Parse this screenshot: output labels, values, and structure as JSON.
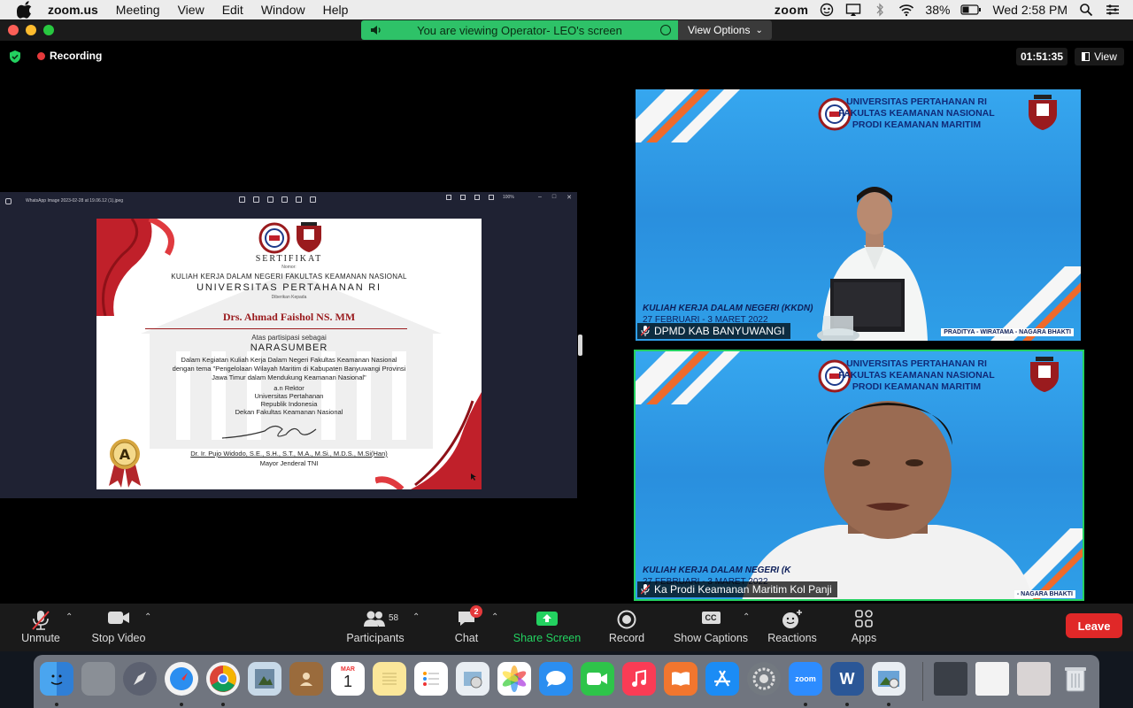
{
  "menubar": {
    "app_name": "zoom.us",
    "items": [
      "Meeting",
      "View",
      "Edit",
      "Window",
      "Help"
    ],
    "zoom_word": "zoom",
    "battery": "38%",
    "clock": "Wed 2:58 PM"
  },
  "banner": {
    "viewing_text": "You are viewing Operator- LEO's screen",
    "view_options": "View Options"
  },
  "meeting": {
    "recording_label": "Recording",
    "timer": "01:51:35",
    "view_label": "View"
  },
  "shared_screen": {
    "viewer_filename": "WhatsApp Image 2023-02-28 at 19.06.12 (1).jpeg",
    "zoom_level": "100%",
    "certificate": {
      "title": "SERTIFIKAT",
      "nomor": "Nomor:",
      "program": "KULIAH KERJA DALAM NEGERI FAKULTAS KEAMANAN NASIONAL",
      "university": "UNIVERSITAS PERTAHANAN RI",
      "given_to": "Diberikan Kepada",
      "recipient": "Drs. Ahmad Faishol NS. MM",
      "atas": "Atas partisipasi sebagai",
      "role": "NARASUMBER",
      "body_1": "Dalam Kegiatan Kuliah Kerja Dalam Negeri Fakultas Keamanan Nasional",
      "body_2": "dengan tema \"Pengelolaan Wilayah Maritim di Kabupaten Banyuwangi Provinsi",
      "body_3": "Jawa Timur dalam Mendukung Keamanan Nasional\"",
      "an_rektor": "a.n Rektor",
      "rektor_1": "Universitas Pertahanan",
      "rektor_2": "Republik Indonesia",
      "rektor_3": "Dekan Fakultas Keamanan Nasional",
      "signer": "Dr. Ir. Pujo Widodo, S.E., S.H., S.T., M.A., M.Si., M.D.S., M.Si(Han)",
      "rank": "Mayor Jenderal TNI",
      "badge_letter": "A"
    }
  },
  "tiles": [
    {
      "header_1": "UNIVERSITAS PERTAHANAN RI",
      "header_2": "FAKULTAS KEAMANAN NASIONAL",
      "header_3": "PRODI KEAMANAN MARITIM",
      "kkdn": "KULIAH KERJA DALAM NEGERI (KKDN)",
      "dates": "27 FEBRUARI - 3 MARET 2022",
      "motto": "PRADITYA - WIRATAMA - NAGARA BHAKTI",
      "participant": "DPMD KAB BANYUWANGI"
    },
    {
      "header_1": "UNIVERSITAS PERTAHANAN RI",
      "header_2": "FAKULTAS KEAMANAN NASIONAL",
      "header_3": "PRODI KEAMANAN MARITIM",
      "kkdn": "KULIAH KERJA DALAM NEGERI (K",
      "dates": "27 FEBRUARI - 3 MARET 2022",
      "motto": "- NAGARA BHAKTI",
      "participant": "Ka Prodi Keamanan Maritim Kol Panji"
    }
  ],
  "toolbar": {
    "unmute": "Unmute",
    "stop_video": "Stop Video",
    "participants": "Participants",
    "participants_count": "58",
    "chat": "Chat",
    "chat_badge": "2",
    "share_screen": "Share Screen",
    "record": "Record",
    "captions": "Show Captions",
    "captions_icon": "CC",
    "reactions": "Reactions",
    "apps": "Apps",
    "leave": "Leave"
  },
  "dock": {
    "calendar_month": "MAR",
    "calendar_day": "1",
    "zoom_label": "zoom",
    "word_label": "W"
  },
  "colors": {
    "recording": "#e5393b",
    "active_speaker": "#23d160",
    "leave": "#e02828",
    "banner": "#2ec268",
    "certificate_accent": "#9a1b1e"
  }
}
